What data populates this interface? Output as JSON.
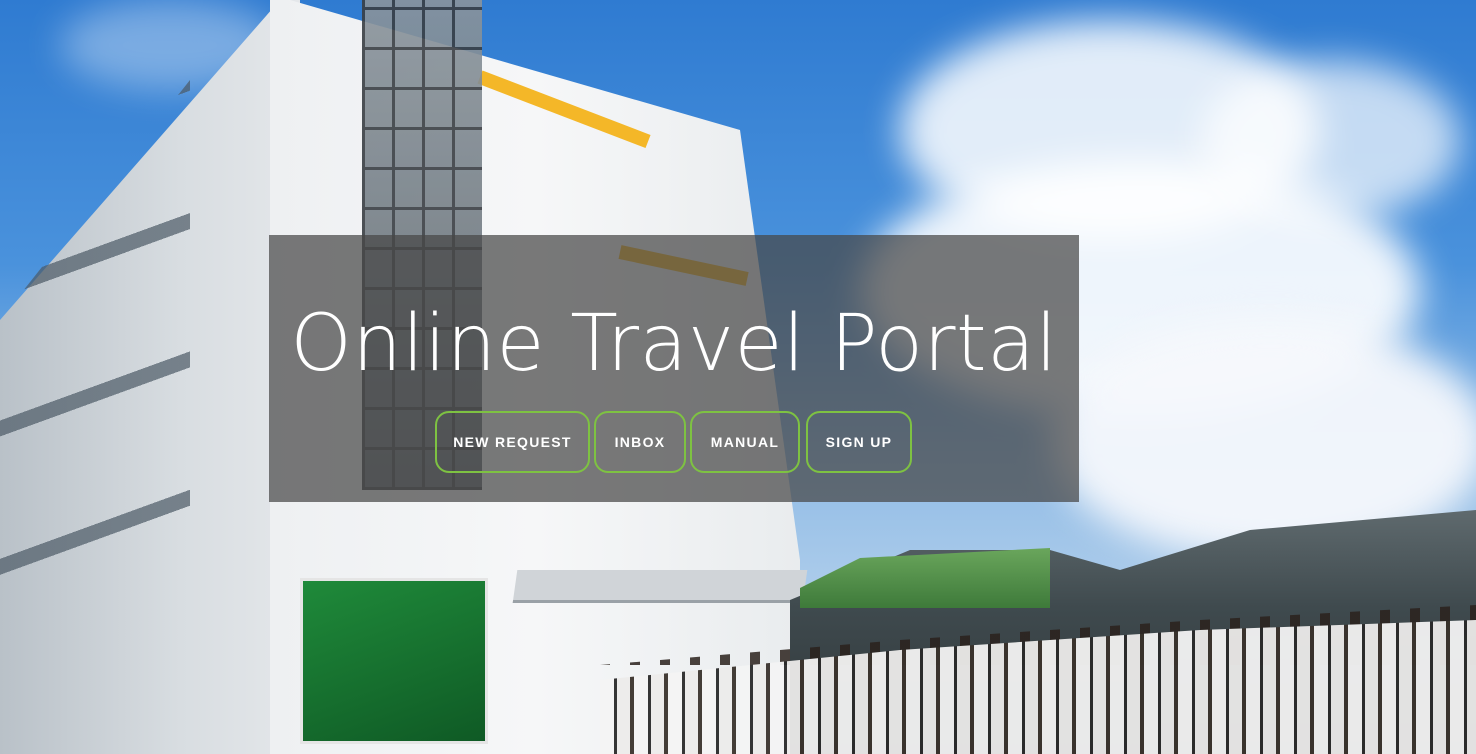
{
  "hero": {
    "title": "Online Travel Portal",
    "buttons": [
      {
        "label": "NEW REQUEST"
      },
      {
        "label": "INBOX"
      },
      {
        "label": "MANUAL"
      },
      {
        "label": "SIGN UP"
      }
    ]
  },
  "colors": {
    "button_border": "#7ec242",
    "panel_overlay": "rgba(70,70,70,0.72)",
    "text": "#ffffff"
  }
}
